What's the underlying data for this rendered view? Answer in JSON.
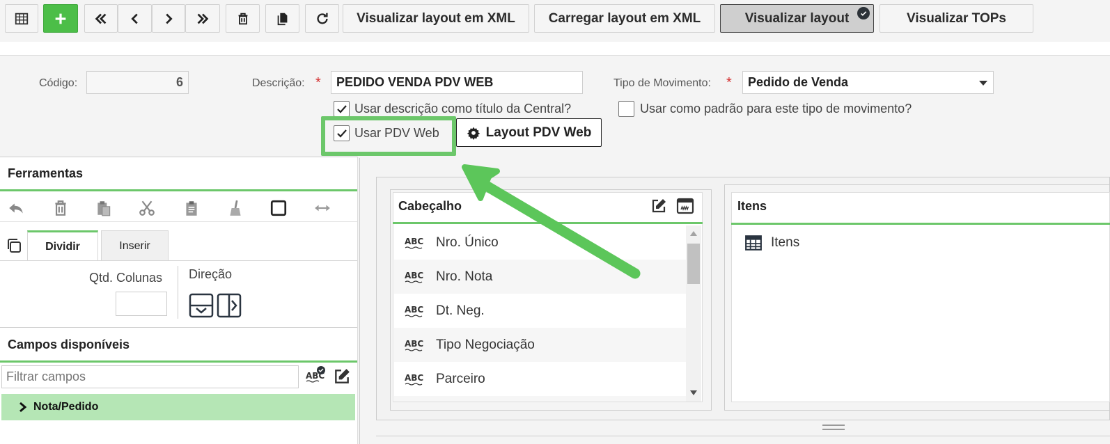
{
  "toolbar": {
    "view_xml": "Visualizar layout em XML",
    "load_xml": "Carregar layout em XML",
    "view_layout": "Visualizar layout",
    "view_tops": "Visualizar TOPs"
  },
  "form": {
    "codigo_label": "Código:",
    "codigo_value": "6",
    "descricao_label": "Descrição:",
    "descricao_value": "PEDIDO VENDA PDV WEB",
    "tipo_label": "Tipo de Movimento:",
    "tipo_value": "Pedido de Venda",
    "chk_titulo": "Usar descrição como título da Central?",
    "chk_padrao": "Usar como padrão para este tipo de movimento?",
    "chk_pdv": "Usar PDV Web",
    "layout_pdv_btn": "Layout PDV Web"
  },
  "ferramentas": {
    "title": "Ferramentas",
    "tabs": [
      "Dividir",
      "Inserir"
    ],
    "qtd_colunas_label": "Qtd. Colunas",
    "direcao_label": "Direção"
  },
  "campos": {
    "title": "Campos disponíveis",
    "filter_placeholder": "Filtrar campos",
    "tree_item": "Nota/Pedido"
  },
  "cabecalho": {
    "title": "Cabeçalho",
    "fields": [
      "Nro. Único",
      "Nro. Nota",
      "Dt. Neg.",
      "Tipo Negociação",
      "Parceiro"
    ]
  },
  "itens": {
    "title": "Itens",
    "item": "Itens"
  },
  "colors": {
    "accent_green": "#4cbe48",
    "highlight_green": "#6cc76a",
    "tree_bg": "#b5e6b5",
    "required_red": "#d43030"
  }
}
